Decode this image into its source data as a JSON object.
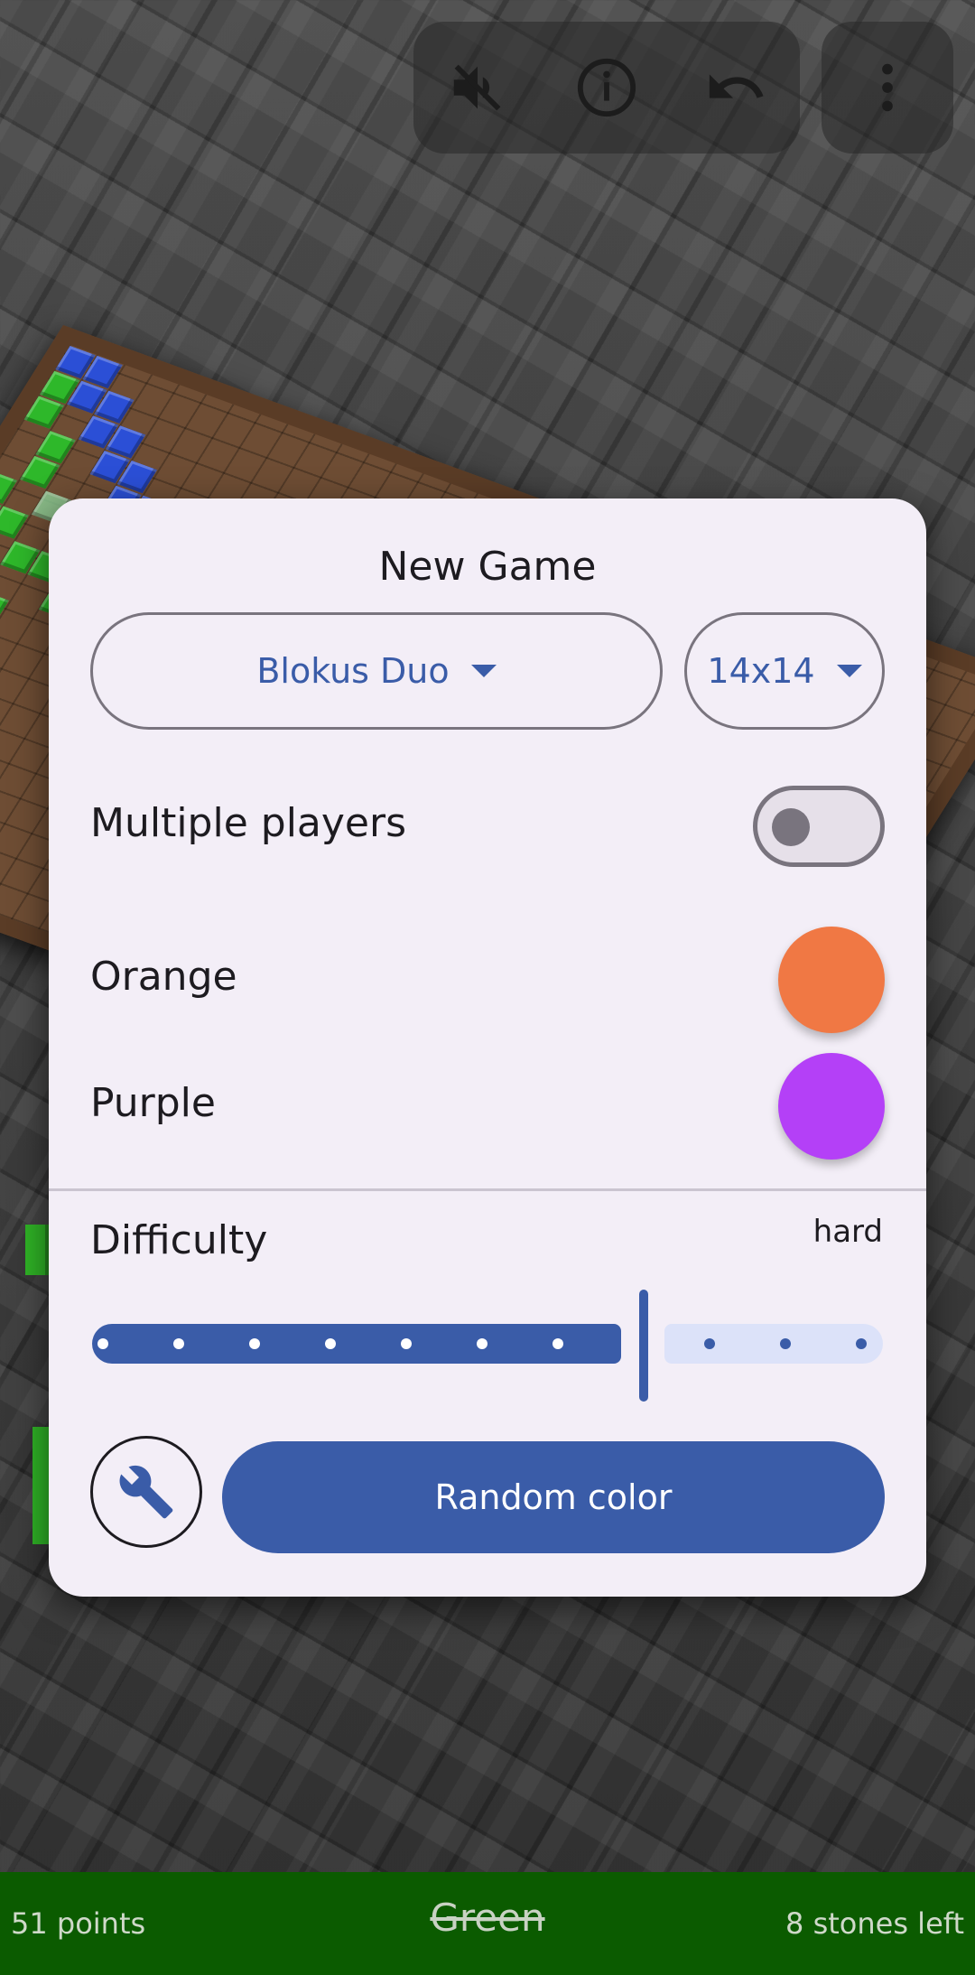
{
  "toolbar": {
    "sound_icon": "volume-off-icon",
    "info_icon": "info-icon",
    "undo_icon": "undo-icon",
    "menu_icon": "more-vert-icon"
  },
  "dialog": {
    "title": "New Game",
    "game_mode": "Blokus Duo",
    "board_size": "14x14",
    "multiple_players_label": "Multiple players",
    "multiple_players_enabled": false,
    "players": [
      {
        "label": "Orange",
        "color": "#f07844"
      },
      {
        "label": "Purple",
        "color": "#b440f7"
      }
    ],
    "difficulty_label": "Difficulty",
    "difficulty_value": "hard",
    "difficulty_level": 8,
    "difficulty_max": 11,
    "settings_icon": "wrench-icon",
    "random_color_label": "Random color"
  },
  "status": {
    "points": "51 points",
    "player": "Green",
    "stones_left": "8 stones left"
  },
  "colors": {
    "accent": "#3a5ca8",
    "status_bar": "#0b5b00",
    "dialog_bg": "#f3eef7"
  }
}
